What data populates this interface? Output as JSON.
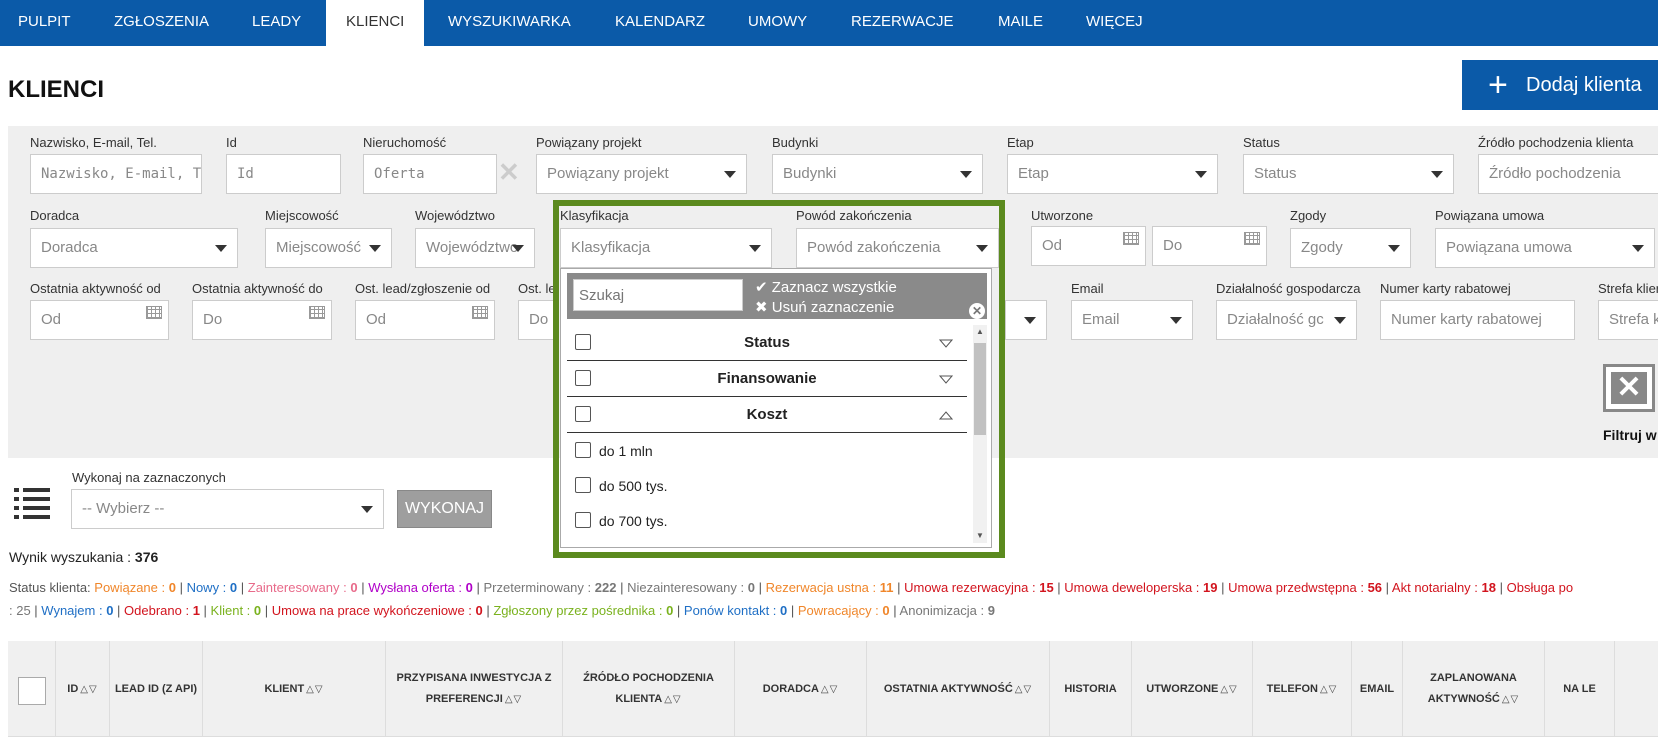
{
  "nav": {
    "items": [
      "PULPIT",
      "ZGŁOSZENIA",
      "LEADY",
      "KLIENCI",
      "WYSZUKIWARKA",
      "KALENDARZ",
      "UMOWY",
      "REZERWACJE",
      "MAILE",
      "WIĘCEJ"
    ],
    "active": "KLIENCI"
  },
  "page": {
    "title": "KLIENCI",
    "add_button": "Dodaj klienta"
  },
  "filters": {
    "row1": [
      {
        "label": "Nazwisko, E-mail, Tel.",
        "placeholder": "Nazwisko, E-mail, Tel."
      },
      {
        "label": "Id",
        "placeholder": "Id"
      },
      {
        "label": "Nieruchomość",
        "placeholder": "Oferta"
      },
      {
        "label": "Powiązany projekt",
        "placeholder": "Powiązany projekt"
      },
      {
        "label": "Budynki",
        "placeholder": "Budynki"
      },
      {
        "label": "Etap",
        "placeholder": "Etap"
      },
      {
        "label": "Status",
        "placeholder": "Status"
      },
      {
        "label": "Źródło pochodzenia klienta",
        "placeholder": "Źródło pochodzenia"
      }
    ],
    "row2": [
      {
        "label": "Doradca",
        "placeholder": "Doradca"
      },
      {
        "label": "Miejscowość",
        "placeholder": "Miejscowość"
      },
      {
        "label": "Województwo",
        "placeholder": "Województwo"
      },
      {
        "label": "Klasyfikacja",
        "placeholder": "Klasyfikacja"
      },
      {
        "label": "Powód zakończenia",
        "placeholder": "Powód zakończenia"
      },
      {
        "label": "Utworzone",
        "placeholder": "Od"
      },
      {
        "label": "",
        "placeholder": "Do"
      },
      {
        "label": "Zgody",
        "placeholder": "Zgody"
      },
      {
        "label": "Powiązana umowa",
        "placeholder": "Powiązana umowa"
      }
    ],
    "row3": [
      {
        "label": "Ostatnia aktywność od",
        "placeholder": "Od"
      },
      {
        "label": "Ostatnia aktywność do",
        "placeholder": "Do"
      },
      {
        "label": "Ost. lead/zgłoszenie od",
        "placeholder": "Od"
      },
      {
        "label": "Ost. le",
        "placeholder": "Do"
      },
      {
        "label": "Email",
        "placeholder": "Email"
      },
      {
        "label": "Działalność gospodarcza",
        "placeholder": "Działalność gc"
      },
      {
        "label": "Numer karty rabatowej",
        "placeholder": "Numer karty rabatowej"
      },
      {
        "label": "Strefa klier",
        "placeholder": "Strefa k"
      }
    ],
    "filter_button": "Filtruj w"
  },
  "dropdown": {
    "search_placeholder": "Szukaj",
    "select_all": "Zaznacz wszystkie",
    "clear_selection": "Usuń zaznaczenie",
    "groups": [
      "Status",
      "Finansowanie",
      "Koszt"
    ],
    "items": [
      "do 1 mln",
      "do 500 tys.",
      "do 700 tys."
    ]
  },
  "bulk": {
    "label": "Wykonaj na zaznaczonych",
    "select_placeholder": "-- Wybierz --",
    "execute": "WYKONAJ"
  },
  "results": {
    "label": "Wynik wyszukania : ",
    "count": "376"
  },
  "statuses_prefix": "Status klienta: ",
  "statuses_line1": [
    {
      "name": "Powiązane",
      "count": "0",
      "color": "#f0862a"
    },
    {
      "name": "Nowy",
      "count": "0",
      "color": "#1f6fc5"
    },
    {
      "name": "Zainteresowany",
      "count": "0",
      "color": "#e86a8a"
    },
    {
      "name": "Wysłana oferta",
      "count": "0",
      "color": "#b000c8"
    },
    {
      "name": "Przeterminowany",
      "count": "222",
      "color": "#777777"
    },
    {
      "name": "Niezainteresowany",
      "count": "0",
      "color": "#777777"
    },
    {
      "name": "Rezerwacja ustna",
      "count": "11",
      "color": "#f0862a"
    },
    {
      "name": "Umowa rezerwacyjna",
      "count": "15",
      "color": "#d2141e"
    },
    {
      "name": "Umowa deweloperska",
      "count": "19",
      "color": "#d2141e"
    },
    {
      "name": "Umowa przedwstępna",
      "count": "56",
      "color": "#d2141e"
    },
    {
      "name": "Akt notarialny",
      "count": "18",
      "color": "#d2141e"
    },
    {
      "name": "Obsługa po",
      "count": "",
      "color": "#d2141e"
    }
  ],
  "statuses_line2_lead": ": 25",
  "statuses_line2": [
    {
      "name": "Wynajem",
      "count": "0",
      "color": "#1f6fc5"
    },
    {
      "name": "Odebrano",
      "count": "1",
      "color": "#d2141e"
    },
    {
      "name": "Klient",
      "count": "0",
      "color": "#7ab21e"
    },
    {
      "name": "Umowa na prace wykończeniowe",
      "count": "0",
      "color": "#d2141e"
    },
    {
      "name": "Zgłoszony przez pośrednika",
      "count": "0",
      "color": "#7ab21e"
    },
    {
      "name": "Ponów kontakt",
      "count": "0",
      "color": "#1f6fc5"
    },
    {
      "name": "Powracający",
      "count": "0",
      "color": "#f0862a"
    },
    {
      "name": "Anonimizacja",
      "count": "9",
      "color": "#777777"
    }
  ],
  "table": {
    "columns": [
      {
        "label": "ID",
        "sortable": true
      },
      {
        "label": "LEAD ID (Z API)",
        "sortable": false
      },
      {
        "label": "KLIENT",
        "sortable": true
      },
      {
        "label": "PRZYPISANA INWESTYCJA Z PREFERENCJI",
        "sortable": true
      },
      {
        "label": "ŹRÓDŁO POCHODZENIA KLIENTA",
        "sortable": true
      },
      {
        "label": "DORADCA",
        "sortable": true
      },
      {
        "label": "OSTATNIA AKTYWNOŚĆ",
        "sortable": true
      },
      {
        "label": "HISTORIA",
        "sortable": false
      },
      {
        "label": "UTWORZONE",
        "sortable": true
      },
      {
        "label": "TELEFON",
        "sortable": true
      },
      {
        "label": "EMAIL",
        "sortable": false
      },
      {
        "label": "ZAPLANOWANA AKTYWNOŚĆ",
        "sortable": true
      },
      {
        "label": "NA LE",
        "sortable": false
      }
    ]
  },
  "colors": {
    "nav_bg": "#0b5aa8",
    "highlight": "#5b8a1e",
    "panel_bg": "#efefef"
  }
}
